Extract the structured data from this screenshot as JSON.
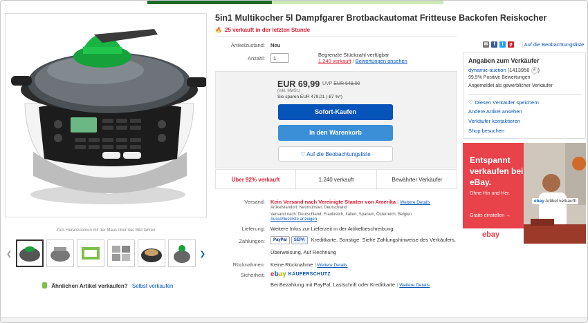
{
  "product": {
    "title": "5in1 Multikocher 5l Dampfgarer Brotbackautomat Fritteuse Backofen Reiskocher",
    "hot_text": "25 verkauft in der letzten Stunde",
    "hot_icon": "flame-icon",
    "zoom_hint": "Zum Heranzoomen mit der Maus über das Bild fahren",
    "sell_similar_question": "Ähnlichen Artikel verkaufen?",
    "sell_similar_link": "Selbst verkaufen"
  },
  "details": {
    "condition_label": "Artikelzustand:",
    "condition_value": "Neu",
    "quantity_label": "Anzahl:",
    "quantity_value": "1",
    "limited_text": "Begrenzte Stückzahl verfügbar",
    "sold_link": "1.240 verkauft",
    "reviews_link": "Bewertungen ansehen"
  },
  "price": {
    "value": "EUR 69,99",
    "uvp_label": "UVP",
    "uvp_value": "EUR 549,00",
    "inkl": "(inkl. MwSt.)",
    "save": "Sie sparen EUR 479,01 (-87 %*)",
    "buy_now": "Sofort-Kaufen",
    "add_to_cart": "In den Warenkorb",
    "watch": "Auf die Beobachtungsliste"
  },
  "stats": [
    "Über 92% verkauft",
    "1.240 verkauft",
    "Bewährter Verkäufer"
  ],
  "shipping": {
    "label": "Versand:",
    "no_ship": "Kein Versand nach Vereinigte Staaten von Amerika",
    "details_link": "Weitere Details",
    "location": "Artikelstandort: Neumünster, Deutschland",
    "ships_to": "Versand nach: Deutschland, Frankreich, Italien, Spanien, Österreich, Belgien",
    "excluded_link": "Ausschlussliste anzeigen"
  },
  "delivery": {
    "label": "Lieferung:",
    "value": "Weitere Infos zur Lieferzeit in der Artikelbeschreibung"
  },
  "payment": {
    "label": "Zahlungen:",
    "paypal": "PayPal",
    "sepa": "SEPA",
    "text1": "Kreditkarte, Sonstige: Siehe Zahlungshinweise des Verkäufers,",
    "text2": "Überweisung, Auf Rechnung"
  },
  "returns": {
    "label": "Rücknahmen:",
    "value": "Keine Rücknahme",
    "details_link": "Weitere Details"
  },
  "security": {
    "label": "Sicherheit:",
    "logo": "ebay",
    "protection": "KÄUFERSCHUTZ",
    "text": "Bei Bezahlung mit PayPal, Lastschrift oder Kreditkarte",
    "details_link": "Weitere Details"
  },
  "share": {
    "icons": [
      "email-icon",
      "facebook-icon",
      "twitter-icon",
      "pinterest-icon"
    ],
    "watch_link": "Auf die Beobachtungsliste"
  },
  "seller": {
    "header": "Angaben zum Verkäufer",
    "name": "dynamic-auction",
    "score": "(1413956",
    "positive": "99,5% Positive Bewertungen",
    "business": "Angemeldet als gewerblicher Verkäufer",
    "save_seller": "Diesen Verkäufer speichern",
    "other_items": "Andere Artikel ansehen",
    "contact": "Verkäufer kontaktieren",
    "shop": "Shop besuchen"
  },
  "ad": {
    "headline": "Entspannt verkaufen bei eBay.",
    "sub": "Ohne Hin und Her.",
    "cta": "Gratis einstellen →",
    "chip": "Artikel verkauft!",
    "chip_logo": "ebay",
    "logo": "ebay"
  },
  "colors": {
    "accent_blue": "#0654ba",
    "alert_red": "#dd1e31",
    "ad_red": "#e8424a"
  }
}
